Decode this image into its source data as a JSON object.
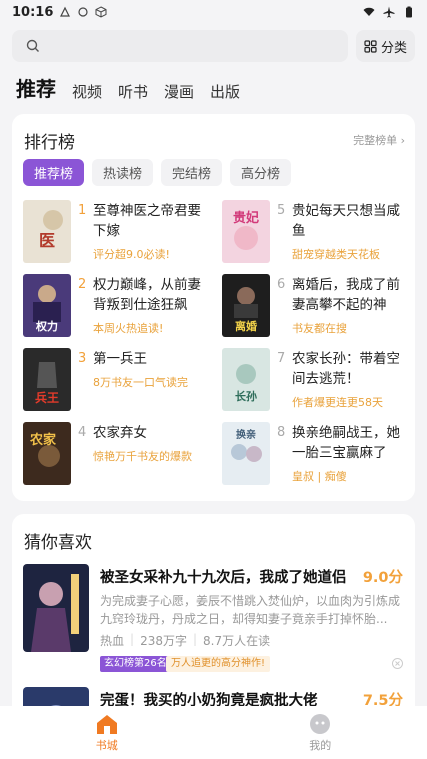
{
  "status_bar": {
    "time": "10:16"
  },
  "search": {
    "placeholder": "",
    "category_label": "分类"
  },
  "top_tabs": [
    "推荐",
    "视频",
    "听书",
    "漫画",
    "出版"
  ],
  "ranking": {
    "title": "排行榜",
    "more_label": "完整榜单",
    "tabs": [
      "推荐榜",
      "热读榜",
      "完结榜",
      "高分榜"
    ],
    "items": [
      {
        "rank": "1",
        "title": "至尊神医之帝君要下嫁",
        "subtitle": "评分超9.0必读!"
      },
      {
        "rank": "2",
        "title": "权力巅峰，从前妻背叛到仕途狂飙",
        "subtitle": "本周火热追读!"
      },
      {
        "rank": "3",
        "title": "第一兵王",
        "subtitle": "8万书友一口气读完"
      },
      {
        "rank": "4",
        "title": "农家弃女",
        "subtitle": "惊艳万千书友的爆款"
      },
      {
        "rank": "5",
        "title": "贵妃每天只想当咸鱼",
        "subtitle": "甜宠穿越类天花板"
      },
      {
        "rank": "6",
        "title": "离婚后，我成了前妻高攀不起的神",
        "subtitle": "书友都在搜"
      },
      {
        "rank": "7",
        "title": "农家长孙：带着空间去逃荒！",
        "subtitle": "作者爆更连更58天"
      },
      {
        "rank": "8",
        "title": "换亲绝嗣战王，她一胎三宝赢麻了",
        "subtitle": "皇叔 | 痴傻"
      }
    ],
    "covers": [
      {
        "text": "医",
        "bg": "#e9e2d4",
        "fg": "#b23a2b"
      },
      {
        "text": "权力",
        "bg": "#4a3a7a",
        "fg": "#ffffff"
      },
      {
        "text": "兵王",
        "bg": "#2a2a2a",
        "fg": "#e23b2b"
      },
      {
        "text": "农家",
        "bg": "#3d2a1e",
        "fg": "#f2c14a"
      },
      {
        "text": "贵妃",
        "bg": "#f3d4e0",
        "fg": "#d23a7a"
      },
      {
        "text": "离婚",
        "bg": "#1e1e1e",
        "fg": "#f2d24a"
      },
      {
        "text": "长孙",
        "bg": "#d8e6e2",
        "fg": "#2e6d5a"
      },
      {
        "text": "换亲",
        "bg": "#e6edf2",
        "fg": "#44607a"
      }
    ]
  },
  "guess": {
    "title": "猜你喜欢",
    "books": [
      {
        "title": "被圣女采补九十九次后，我成了她道侣",
        "score": "9.0分",
        "desc": "为完成妻子心愿，姜辰不惜跳入焚仙炉，以血肉为引炼成九窍玲珑丹，丹成之日，却得知妻子竟亲手打掉怀胎...",
        "meta": [
          "热血",
          "238万字",
          "8.7万人在读"
        ],
        "tag_rank": "玄幻榜第26名",
        "tag_hot": "万人追更的高分神作!"
      },
      {
        "title": "完蛋！我买的小奶狗竟是疯批大佬",
        "score": "7.5分"
      }
    ]
  },
  "bottom_nav": {
    "home_label": "书城",
    "me_label": "我的"
  },
  "colors": {
    "accent": "#f07a22",
    "purple": "#8b55d6",
    "rank_orange": "#f2a13a"
  }
}
